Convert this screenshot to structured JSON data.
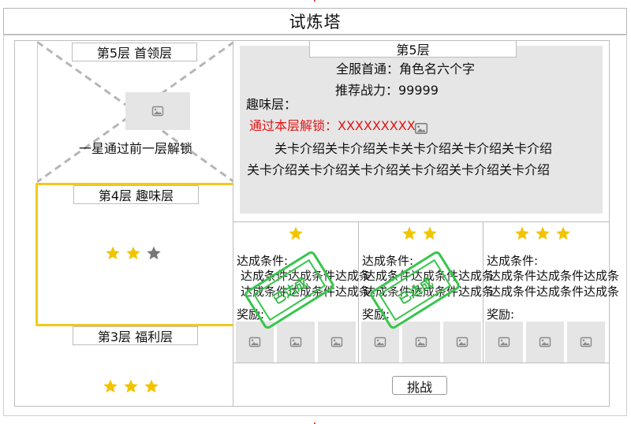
{
  "app": {
    "title": "试炼塔"
  },
  "tower": {
    "floors": {
      "fifth": {
        "label": "第5层 首领层",
        "unlock_text": "一星通过前一层解锁",
        "image_icon": "image-icon"
      },
      "fourth": {
        "label": "第4层 趣味层",
        "stars": {
          "earned": 2,
          "total": 3
        }
      },
      "third": {
        "label": "第3层 福利层",
        "stars": {
          "earned": 3,
          "total": 3
        }
      }
    }
  },
  "detail": {
    "floor_title": "第5层",
    "first_clear": "全服首通：角色名六个字",
    "recommended_power": "推荐战力：99999",
    "floor_type": "趣味层：",
    "unlock_requirement": "通过本层解锁：XXXXXXXXX",
    "intro_lines": [
      "关卡介绍关卡介绍关卡关卡介绍关卡介绍关卡介绍",
      "关卡介绍关卡介绍关卡介绍关卡介绍关卡介绍关卡介绍"
    ],
    "objectives": [
      {
        "stars": 1,
        "condition_label": "达成条件:",
        "condition_line_1": "达成条件达成条件达成条",
        "condition_line_2": "达成条件达成条件达成条",
        "reward_label": "奖励:",
        "stamp": "已达成",
        "reward_icons": [
          "image-icon",
          "image-icon",
          "image-icon"
        ]
      },
      {
        "stars": 2,
        "condition_label": "达成条件:",
        "condition_line_1": "达成条件达成条件达成条",
        "condition_line_2": "达成条件达成条件达成条",
        "reward_label": "奖励:",
        "stamp": "已达成",
        "reward_icons": [
          "image-icon",
          "image-icon",
          "image-icon"
        ]
      },
      {
        "stars": 3,
        "condition_label": "达成条件:",
        "condition_line_1": "达成条件达成条件达成条",
        "condition_line_2": "达成条件达成条件达成条",
        "reward_label": "奖励:",
        "reward_icons": [
          "image-icon",
          "image-icon",
          "image-icon"
        ]
      }
    ],
    "challenge_button": "挑战"
  },
  "colors": {
    "selected_border": "#f2c91c",
    "star_filled": "#f2c400",
    "star_empty": "#777777",
    "placeholder": "#e6e6e6",
    "unlock_red": "#e11515",
    "stamp_green": "#36c64b"
  }
}
